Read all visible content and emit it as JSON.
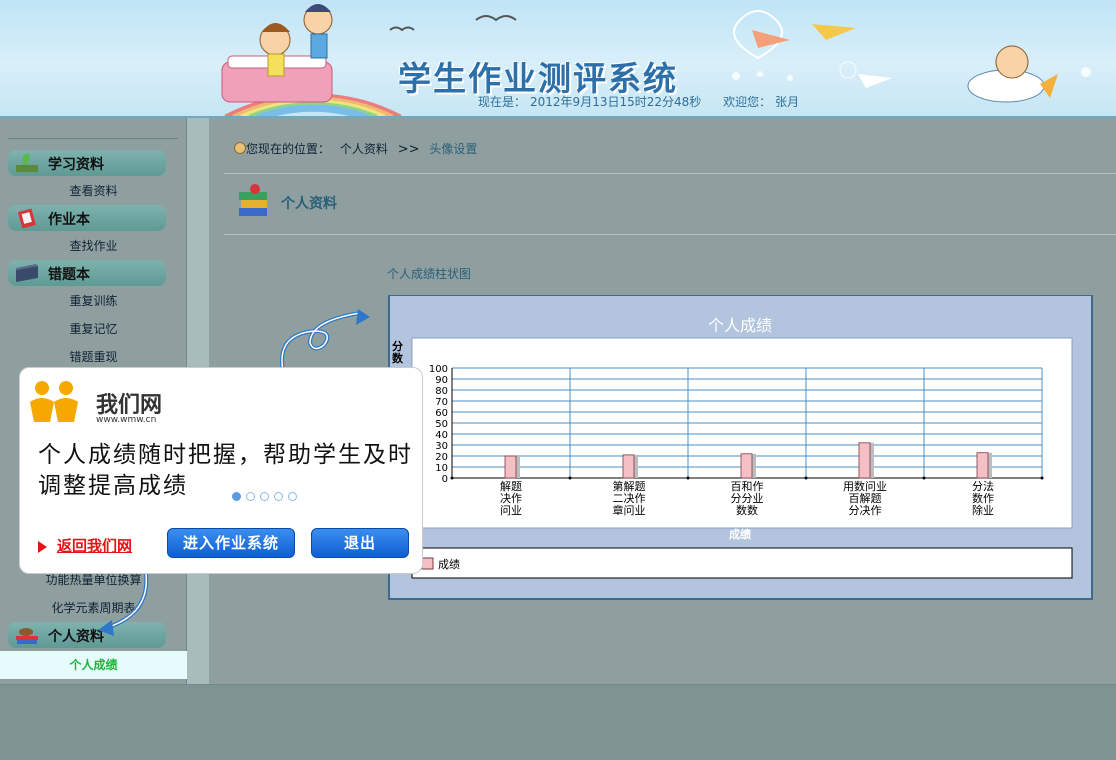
{
  "header": {
    "system_title": "学生作业测评系统",
    "now_label": "现在是：",
    "now_value": "2012年9月13日15时22分48秒",
    "welcome_label": "欢迎您：",
    "user_name": "张月"
  },
  "sidebar": {
    "categories": [
      {
        "label": "学习资料",
        "icon": "plant-book-icon"
      },
      {
        "label": "作业本",
        "icon": "red-notebook-icon"
      },
      {
        "label": "错题本",
        "icon": "dark-book-icon"
      },
      {
        "label": "个人资料",
        "icon": "books-hat-icon"
      }
    ],
    "items": {
      "view_materials": "查看资料",
      "find_homework": "查找作业",
      "repeat_training": "重复训练",
      "repeat_memory": "重复记忆",
      "wrong_reappear": "错题重现",
      "unit_convert": "功能热量单位换算",
      "periodic_table": "化学元素周期表",
      "personal_score": "个人成绩"
    }
  },
  "main": {
    "crumb_label": "您现在的位置：",
    "crumb_parent": "个人资料",
    "crumb_sep": ">>",
    "crumb_current": "头像设置",
    "section_title": "个人资料",
    "chart_caption": "个人成绩柱状图"
  },
  "chart_data": {
    "type": "bar",
    "title": "个人成绩",
    "ylabel": "分数",
    "xlabel": "成绩",
    "ylim": [
      0,
      100
    ],
    "yticks": [
      0,
      10,
      20,
      30,
      40,
      50,
      60,
      70,
      80,
      90,
      100
    ],
    "categories": [
      [
        "解题",
        "决作",
        "问业"
      ],
      [
        "第解题",
        "二决作",
        "章问业"
      ],
      [
        "百和作",
        "分分业",
        "数数"
      ],
      [
        "用数问业",
        "百解题",
        "分决作"
      ],
      [
        "分法",
        "数作",
        "除业"
      ]
    ],
    "series": [
      {
        "name": "成绩",
        "values": [
          20,
          21,
          22,
          32,
          23
        ]
      }
    ],
    "colors": {
      "bar": "#f4c0c6",
      "bar_side": "#bdbdbd",
      "grid": "#4a8fc9",
      "plot_bg": "#ffffff",
      "panel_bg": "#b2c4de"
    },
    "legend_placement": "bottom"
  },
  "popup": {
    "brand_text": "我们网",
    "brand_url": "www.wmw.cn",
    "message": "个人成绩随时把握，帮助学生及时调整提高成绩",
    "back_link": "返回我们网",
    "enter_button": "进入作业系统",
    "exit_button": "退出",
    "dots": [
      true,
      false,
      false,
      false,
      false
    ]
  }
}
